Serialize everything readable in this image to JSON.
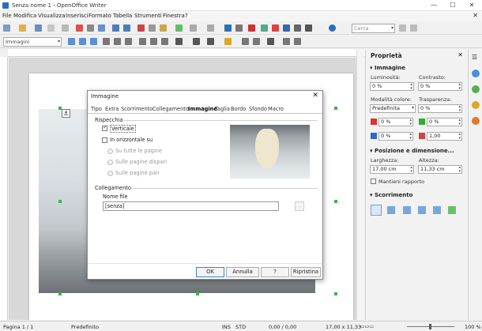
{
  "window": {
    "title": "Senza nome 1 - OpenOffice Writer",
    "minimize": "—",
    "maximize": "☐",
    "close": "✕"
  },
  "menu": {
    "items": [
      "File",
      "Modifica",
      "Visualizza",
      "Inserisci",
      "Formato",
      "Tabella",
      "Strumenti",
      "Finestra",
      "?"
    ],
    "close_doc": "✕"
  },
  "toolbar": {
    "search_placeholder": "Cerca",
    "style_value": "Immagini"
  },
  "sidebar": {
    "title": "Proprietà",
    "image_section": "Immagine",
    "brightness_label": "Luminosità:",
    "brightness_value": "0 %",
    "contrast_label": "Contrasto:",
    "contrast_value": "0 %",
    "color_mode_label": "Modalità colore:",
    "color_mode_value": "Predefinita",
    "transparency_label": "Trasparenza:",
    "transparency_value": "0 %",
    "red_value": "0 %",
    "green_value": "0 %",
    "blue_value": "0 %",
    "gamma_value": "1,00",
    "position_section": "Posizione e dimensione...",
    "width_label": "Larghezza:",
    "width_value": "17,00 cm",
    "height_label": "Altezza:",
    "height_value": "11,33 cm",
    "keep_ratio_label": "Mantieni rapporto",
    "wrap_section": "Scorrimento"
  },
  "dialog": {
    "title": "Immagine",
    "tabs": [
      "Tipo",
      "Extra",
      "Scorrimento",
      "Collegamento",
      "Immagine",
      "Taglia",
      "Bordo",
      "Sfondo",
      "Macro"
    ],
    "active_tab": "Immagine",
    "flip_group": "Rispecchia",
    "vertical_label": "Verticale",
    "vertical_checked": true,
    "horizontal_label": "In orizzontale su",
    "horizontal_checked": false,
    "all_pages": "Su tutte le pagine",
    "odd_pages": "Sulle pagine dispari",
    "even_pages": "Sulle pagine pari",
    "link_group": "Collegamento",
    "filename_label": "Nome file",
    "filename_value": "[senza]",
    "browse": "...",
    "buttons": {
      "ok": "OK",
      "cancel": "Annulla",
      "help": "?",
      "reset": "Ripristina"
    }
  },
  "statusbar": {
    "page": "Pagina 1 / 1",
    "style": "Predefinito",
    "ins": "INS",
    "std": "STD",
    "position": "0,00 / 0,00",
    "size": "17,00 x 11,33",
    "zoom": "100 %"
  },
  "colors": {
    "handles": "#3ab54a",
    "accent": "#1a5cb0"
  }
}
